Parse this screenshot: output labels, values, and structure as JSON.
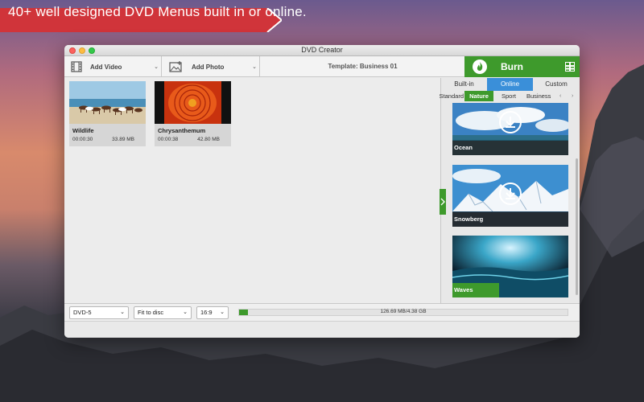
{
  "banner": {
    "text": "40+ well designed DVD Menus built in or online.",
    "color": "#d0343a"
  },
  "window": {
    "title": "DVD Creator"
  },
  "toolbar": {
    "add_video": "Add Video",
    "add_photo": "Add Photo",
    "template": "Template: Business 01",
    "burn": "Burn"
  },
  "clips": [
    {
      "name": "Wildlife",
      "duration": "00:00:30",
      "size": "33.89 MB"
    },
    {
      "name": "Chrysanthemum",
      "duration": "00:00:38",
      "size": "42.80 MB"
    }
  ],
  "sidebar": {
    "tabs": [
      {
        "label": "Built-in",
        "active": false
      },
      {
        "label": "Online",
        "active": true
      },
      {
        "label": "Custom",
        "active": false
      }
    ],
    "subtabs": [
      {
        "label": "Standard",
        "active": false
      },
      {
        "label": "Nature",
        "active": true
      },
      {
        "label": "Sport",
        "active": false
      },
      {
        "label": "Business",
        "active": false
      }
    ],
    "menus": [
      {
        "name": "Ocean",
        "downloadable": true
      },
      {
        "name": "Snowberg",
        "downloadable": true
      },
      {
        "name": "Waves",
        "downloadable": false,
        "progress": 0.4
      }
    ]
  },
  "bottom": {
    "disc_type": "DVD-5",
    "fit_mode": "Fit to disc",
    "aspect": "16:9",
    "capacity_text": "126.69 MB/4.38 GB",
    "capacity_fraction": 0.028
  },
  "colors": {
    "accent_green": "#3e9a2c",
    "accent_blue": "#3a8fd9",
    "banner_red": "#d0343a"
  }
}
